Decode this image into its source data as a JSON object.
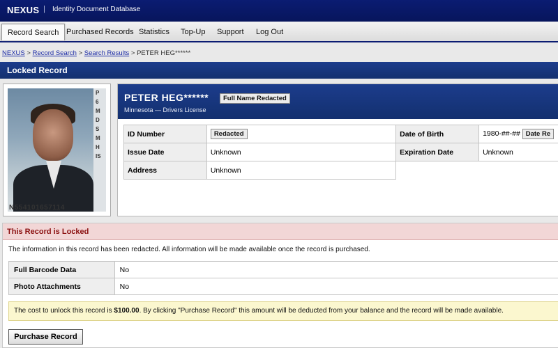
{
  "header": {
    "brand": "NEXUS",
    "separator": "|",
    "subtitle": "Identity Document Database"
  },
  "nav": {
    "items": [
      {
        "label": "Record Search",
        "active": true
      },
      {
        "label": "Purchased Records"
      },
      {
        "label": "Statistics"
      },
      {
        "label": "Top-Up"
      },
      {
        "label": "Support"
      },
      {
        "label": "Log Out"
      }
    ]
  },
  "breadcrumb": {
    "items": [
      "NEXUS",
      "Record Search",
      "Search Results"
    ],
    "separator": ">",
    "current": "PETER HEG******"
  },
  "page": {
    "title": "Locked Record"
  },
  "photo": {
    "strip_letters": [
      "P",
      "6",
      "M",
      "D",
      "S",
      "M",
      "H",
      "IS"
    ],
    "card_number": "N554101657114"
  },
  "record": {
    "name": "PETER HEG******",
    "name_badge": "Full Name Redacted",
    "subtitle": "Minnesota — Drivers License",
    "fields": {
      "id_number": {
        "label": "ID Number",
        "badge": "Redacted"
      },
      "dob": {
        "label": "Date of Birth",
        "value": "1980-##-##",
        "badge": "Date Re"
      },
      "issue_date": {
        "label": "Issue Date",
        "value": "Unknown"
      },
      "expiration_date": {
        "label": "Expiration Date",
        "value": "Unknown"
      },
      "address": {
        "label": "Address",
        "value": "Unknown"
      }
    }
  },
  "locked": {
    "header": "This Record is Locked",
    "description": "The information in this record has been redacted. All information will be made available once the record is purchased.",
    "rows": [
      {
        "label": "Full Barcode Data",
        "value": "No"
      },
      {
        "label": "Photo Attachments",
        "value": "No"
      }
    ],
    "notice": {
      "prefix": "The cost to unlock this record is ",
      "price": "$100.00",
      "suffix": ". By clicking \"Purchase Record\" this amount will be deducted from your balance and the record will be made available."
    },
    "button_label": "Purchase Record"
  },
  "colors": {
    "header_bg": "#0b1c72",
    "section_bar": "#1c3c8c",
    "locked_bg": "#f2d6d6",
    "locked_text": "#8b1010",
    "notice_bg": "#fbf7cf"
  }
}
